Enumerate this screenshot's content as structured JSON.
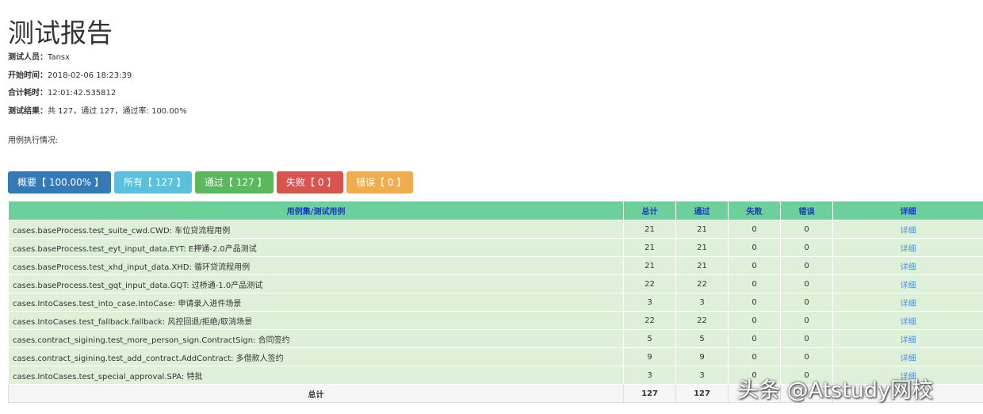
{
  "report": {
    "title": "测试报告",
    "tester_label": "测试人员：",
    "tester": "Tansx",
    "start_label": "开始时间：",
    "start_time": "2018-02-06 18:23:39",
    "duration_label": "合计耗时：",
    "duration": "12:01:42.535812",
    "result_label": "测试结果：",
    "result": "共 127，通过 127，通过率: 100.00%",
    "exec_label": "用例执行情况:"
  },
  "buttons": {
    "summary": "概要【 100.00% 】",
    "all": "所有【 127 】",
    "pass": "通过【 127 】",
    "fail": "失败【 0 】",
    "error": "错误【 0 】"
  },
  "colors": {
    "summary": "#337ab7",
    "all": "#5bc0de",
    "pass": "#5cb85c",
    "fail": "#d9534f",
    "error": "#f0ad4e",
    "header_bg": "#6bd09a",
    "row_bg": "#dff0d8"
  },
  "table": {
    "headers": [
      "用例集/测试用例",
      "总计",
      "通过",
      "失败",
      "错误",
      "详细"
    ],
    "rows": [
      {
        "name": "cases.baseProcess.test_suite_cwd.CWD: 车位贷流程用例",
        "total": "21",
        "pass": "21",
        "fail": "0",
        "error": "0",
        "detail": "详细"
      },
      {
        "name": "cases.baseProcess.test_eyt_input_data.EYT: E押通-2.0产品测试",
        "total": "21",
        "pass": "21",
        "fail": "0",
        "error": "0",
        "detail": "详细"
      },
      {
        "name": "cases.baseProcess.test_xhd_input_data.XHD: 循环贷流程用例",
        "total": "21",
        "pass": "21",
        "fail": "0",
        "error": "0",
        "detail": "详细"
      },
      {
        "name": "cases.baseProcess.test_gqt_input_data.GQT: 过桥通-1.0产品测试",
        "total": "22",
        "pass": "22",
        "fail": "0",
        "error": "0",
        "detail": "详细"
      },
      {
        "name": "cases.IntoCases.test_into_case.IntoCase: 申请录入进件场景",
        "total": "3",
        "pass": "3",
        "fail": "0",
        "error": "0",
        "detail": "详细"
      },
      {
        "name": "cases.IntoCases.test_fallback.fallback: 风控回退/拒绝/取消场景",
        "total": "22",
        "pass": "22",
        "fail": "0",
        "error": "0",
        "detail": "详细"
      },
      {
        "name": "cases.contract_sigining.test_more_person_sign.ContractSign: 合同签约",
        "total": "5",
        "pass": "5",
        "fail": "0",
        "error": "0",
        "detail": "详细"
      },
      {
        "name": "cases.contract_sigining.test_add_contract.AddContract: 多借款人签约",
        "total": "9",
        "pass": "9",
        "fail": "0",
        "error": "0",
        "detail": "详细"
      },
      {
        "name": "cases.IntoCases.test_special_approval.SPA: 特批",
        "total": "3",
        "pass": "3",
        "fail": "0",
        "error": "0",
        "detail": "详细"
      }
    ],
    "footer": {
      "label": "总计",
      "total": "127",
      "pass": "127"
    }
  },
  "watermark": "头条 @Atstudy网校"
}
